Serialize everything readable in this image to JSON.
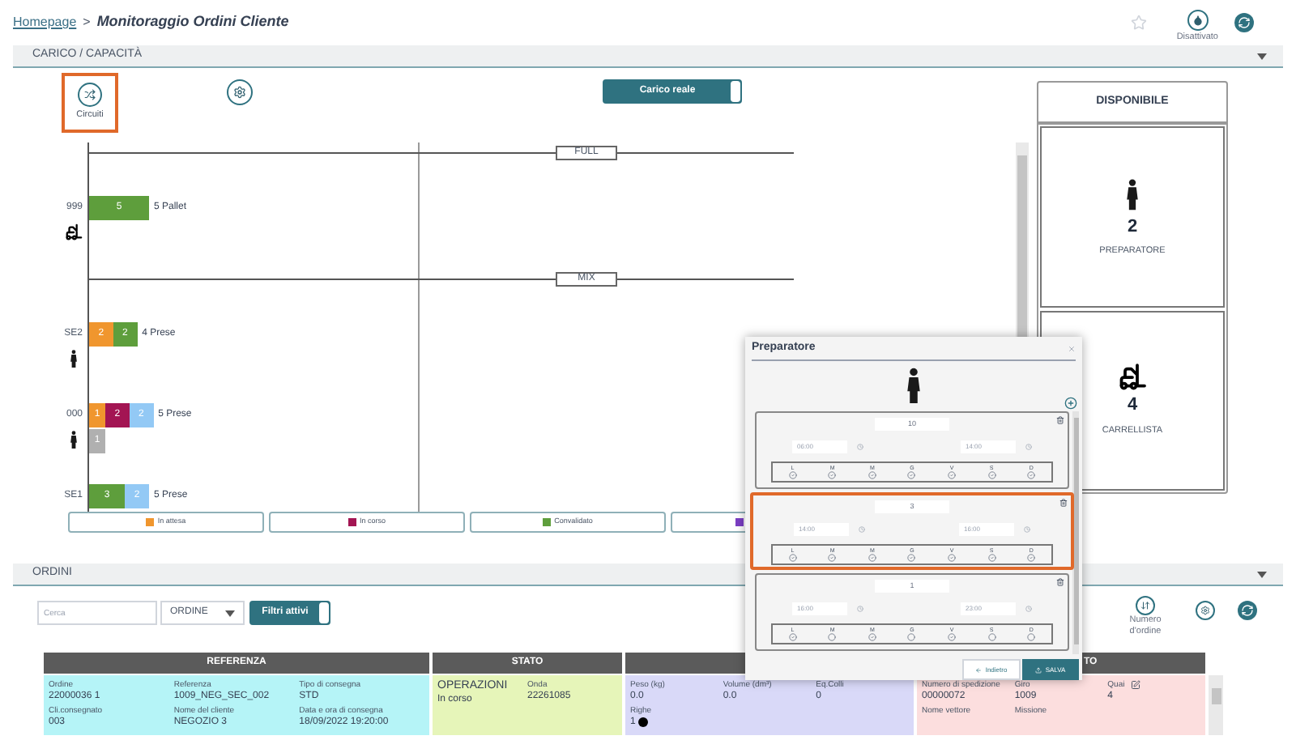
{
  "breadcrumb": {
    "link": "Homepage",
    "separator": ">",
    "title": "Monitoraggio Ordini Cliente"
  },
  "header_actions": {
    "favorite": false,
    "status_label": "Disattivato"
  },
  "load_section": {
    "title": "CARICO / CAPACITÀ",
    "toolbar": {
      "circuits_label": "Circuiti",
      "circuits_highlighted": true,
      "toggle_label": "Carico reale",
      "toggle_on": true
    },
    "chart": {
      "groups": [
        {
          "label": "FULL",
          "rows": [
            {
              "name": "999",
              "kind": "forklift",
              "total": "5 Pallet",
              "lines": [
                [
                  {
                    "value": "5",
                    "color": "#5e9e3c"
                  }
                ]
              ]
            }
          ]
        },
        {
          "label": "MIX",
          "rows": [
            {
              "name": "SE2",
              "kind": "person",
              "total": "4 Prese",
              "lines": [
                [
                  {
                    "value": "2",
                    "color": "#f0962e"
                  },
                  {
                    "value": "2",
                    "color": "#5e9e3c"
                  }
                ]
              ]
            },
            {
              "name": "000",
              "kind": "person",
              "total": "5 Prese",
              "lines": [
                [
                  {
                    "value": "1",
                    "color": "#f0962e"
                  },
                  {
                    "value": "2",
                    "color": "#a31553"
                  },
                  {
                    "value": "2",
                    "color": "#93c9f5"
                  }
                ],
                [
                  {
                    "value": "1",
                    "color": "#b0b0b0"
                  }
                ]
              ]
            },
            {
              "name": "SE1",
              "kind": "plain",
              "total": "5 Prese",
              "lines": [
                [
                  {
                    "value": "3",
                    "color": "#5e9e3c"
                  },
                  {
                    "value": "2",
                    "color": "#93c9f5"
                  }
                ]
              ]
            }
          ]
        }
      ],
      "legend": [
        {
          "label": "In attesa",
          "color": "#f0962e"
        },
        {
          "label": "In corso",
          "color": "#a31553"
        },
        {
          "label": "Convalidato",
          "color": "#5e9e3c"
        },
        {
          "color": "#7b3fc4"
        }
      ]
    }
  },
  "availability": {
    "title": "DISPONIBILE",
    "resources": [
      {
        "kind": "person",
        "count": "2",
        "label": "PREPARATORE"
      },
      {
        "kind": "forklift",
        "count": "4",
        "label": "CARRELLISTA"
      }
    ]
  },
  "orders_section": {
    "title": "ORDINI",
    "search": {
      "placeholder": "Cerca"
    },
    "type_select": "ORDINE",
    "filter_toggle": {
      "label": "Filtri attivi",
      "on": true
    },
    "sort_label": "Numero d'ordine",
    "groups": [
      {
        "header": "REFERENZA",
        "color": "#b5f4f7",
        "fields": [
          {
            "label": "Ordine",
            "value": "22000036 1"
          },
          {
            "label": "Referenza",
            "value": "1009_NEG_SEC_002"
          },
          {
            "label": "Tipo di consegna",
            "value": "STD"
          },
          {
            "label": "Cli.consegnato",
            "value": "003"
          },
          {
            "label": "Nome del cliente",
            "value": "NEGOZIO 3"
          },
          {
            "label": "Data e ora di consegna",
            "value": "18/09/2022 19:20:00"
          }
        ]
      },
      {
        "header": "STATO",
        "color": "#e6f5b9",
        "fields": [
          {
            "label": "OPERAZIONI",
            "value": "In corso",
            "emphasis": true
          },
          {
            "label": "Onda",
            "value": "22261085"
          }
        ]
      },
      {
        "color": "#d9d9f8",
        "fields": [
          {
            "label": "Peso (kg)",
            "value": "0.0"
          },
          {
            "label": "Volume (dm³)",
            "value": "0.0"
          },
          {
            "label": "Eq.Colli",
            "value": "0"
          },
          {
            "label": "Righe",
            "value": "1",
            "info_icon": true
          }
        ]
      },
      {
        "header": "TO",
        "color": "#fcdede",
        "fields": [
          {
            "label": "Numero di spedizione",
            "value": "00000072"
          },
          {
            "label": "Giro",
            "value": "1009"
          },
          {
            "label": "Quai",
            "value": "4",
            "editable": true
          },
          {
            "label": "Nome vettore"
          },
          {
            "label": "Missione"
          }
        ]
      }
    ]
  },
  "dialog": {
    "title": "Preparatore",
    "back_label": "Indietro",
    "save_label": "SALVA",
    "slots": [
      {
        "count": "10",
        "start": "06:00",
        "end": "14:00",
        "highlighted": false,
        "days": [
          {
            "letter": "L",
            "checked": true
          },
          {
            "letter": "M",
            "checked": true
          },
          {
            "letter": "M",
            "checked": true
          },
          {
            "letter": "G",
            "checked": true
          },
          {
            "letter": "V",
            "checked": true
          },
          {
            "letter": "S",
            "checked": true
          },
          {
            "letter": "D",
            "checked": true
          }
        ]
      },
      {
        "count": "3",
        "start": "14:00",
        "end": "16:00",
        "highlighted": true,
        "days": [
          {
            "letter": "L",
            "checked": true
          },
          {
            "letter": "M",
            "checked": true
          },
          {
            "letter": "M",
            "checked": true
          },
          {
            "letter": "G",
            "checked": true
          },
          {
            "letter": "V",
            "checked": true
          },
          {
            "letter": "S",
            "checked": true
          },
          {
            "letter": "D",
            "checked": true
          }
        ]
      },
      {
        "count": "1",
        "start": "16:00",
        "end": "23:00",
        "highlighted": false,
        "days": [
          {
            "letter": "L",
            "checked": true
          },
          {
            "letter": "M",
            "checked": false
          },
          {
            "letter": "M",
            "checked": true
          },
          {
            "letter": "G",
            "checked": false
          },
          {
            "letter": "V",
            "checked": true
          },
          {
            "letter": "S",
            "checked": false
          },
          {
            "letter": "D",
            "checked": false
          }
        ]
      }
    ]
  }
}
